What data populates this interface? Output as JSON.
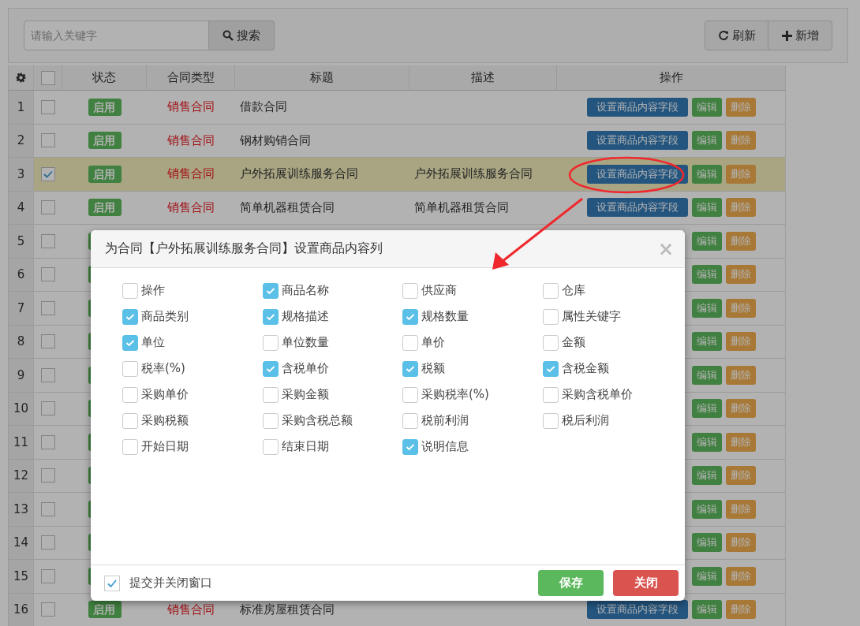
{
  "toolbar": {
    "search": {
      "placeholder": "请输入关键字"
    },
    "search_button": "搜索",
    "refresh_button": "刷新",
    "add_button": "新增"
  },
  "table": {
    "columns": [
      "状态",
      "合同类型",
      "标题",
      "描述",
      "操作"
    ],
    "all_checked": false,
    "rows": [
      {
        "number": "1",
        "checked": false,
        "selected": false,
        "status": "启用",
        "type": "销售合同",
        "title": "借款合同",
        "set_button": "设置商品内容字段",
        "edit_button": "编辑",
        "delete_button": "删除"
      },
      {
        "number": "2",
        "checked": false,
        "selected": false,
        "status": "启用",
        "type": "销售合同",
        "title": "钢材购销合同",
        "set_button": "设置商品内容字段",
        "edit_button": "编辑",
        "delete_button": "删除"
      },
      {
        "number": "3",
        "checked": true,
        "selected": true,
        "status": "启用",
        "type": "销售合同",
        "title": "户外拓展训练服务合同",
        "description": "户外拓展训练服务合同",
        "set_button": "设置商品内容字段",
        "edit_button": "编辑",
        "delete_button": "删除"
      },
      {
        "number": "4",
        "checked": false,
        "selected": false,
        "status": "启用",
        "type": "销售合同",
        "title": "简单机器租赁合同",
        "description": "简单机器租赁合同",
        "set_button": "设置商品内容字段",
        "edit_button": "编辑",
        "delete_button": "删除"
      },
      {
        "number": "5",
        "checked": false,
        "selected": false,
        "edit_button": "编辑",
        "delete_button": "删除"
      },
      {
        "number": "6",
        "checked": false,
        "selected": false,
        "edit_button": "编辑",
        "delete_button": "删除"
      },
      {
        "number": "7",
        "checked": false,
        "selected": false,
        "edit_button": "编辑",
        "delete_button": "删除"
      },
      {
        "number": "8",
        "checked": false,
        "selected": false,
        "edit_button": "编辑",
        "delete_button": "删除"
      },
      {
        "number": "9",
        "checked": false,
        "selected": false,
        "edit_button": "编辑",
        "delete_button": "删除"
      },
      {
        "number": "10",
        "checked": false,
        "selected": false,
        "edit_button": "编辑",
        "delete_button": "删除"
      },
      {
        "number": "11",
        "checked": false,
        "selected": false,
        "edit_button": "编辑",
        "delete_button": "删除"
      },
      {
        "number": "12",
        "checked": false,
        "selected": false,
        "edit_button": "编辑",
        "delete_button": "删除"
      },
      {
        "number": "13",
        "checked": false,
        "selected": false,
        "edit_button": "编辑",
        "delete_button": "删除"
      },
      {
        "number": "14",
        "checked": false,
        "selected": false,
        "edit_button": "编辑",
        "delete_button": "删除"
      },
      {
        "number": "15",
        "checked": false,
        "selected": false,
        "edit_button": "编辑",
        "delete_button": "删除"
      },
      {
        "number": "16",
        "checked": false,
        "selected": false,
        "status": "启用",
        "type": "销售合同",
        "title": "标准房屋租赁合同",
        "set_button": "设置商品内容字段",
        "edit_button": "编辑",
        "delete_button": "删除"
      }
    ]
  },
  "dialog": {
    "title": "为合同【户外拓展训练服务合同】设置商品内容列",
    "close": "×",
    "fields": [
      {
        "label": "操作",
        "checked": false
      },
      {
        "label": "商品名称",
        "checked": true
      },
      {
        "label": "供应商",
        "checked": false
      },
      {
        "label": "仓库",
        "checked": false
      },
      {
        "label": "商品类别",
        "checked": true
      },
      {
        "label": "规格描述",
        "checked": true
      },
      {
        "label": "规格数量",
        "checked": true
      },
      {
        "label": "属性关键字",
        "checked": false
      },
      {
        "label": "单位",
        "checked": true
      },
      {
        "label": "单位数量",
        "checked": false
      },
      {
        "label": "单价",
        "checked": false
      },
      {
        "label": "金额",
        "checked": false
      },
      {
        "label": "税率(%)",
        "checked": false
      },
      {
        "label": "含税单价",
        "checked": true
      },
      {
        "label": "税额",
        "checked": true
      },
      {
        "label": "含税金额",
        "checked": true
      },
      {
        "label": "采购单价",
        "checked": false
      },
      {
        "label": "采购金额",
        "checked": false
      },
      {
        "label": "采购税率(%)",
        "checked": false
      },
      {
        "label": "采购含税单价",
        "checked": false
      },
      {
        "label": "采购税额",
        "checked": false
      },
      {
        "label": "采购含税总额",
        "checked": false
      },
      {
        "label": "税前利润",
        "checked": false
      },
      {
        "label": "税后利润",
        "checked": false
      },
      {
        "label": "开始日期",
        "checked": false
      },
      {
        "label": "结束日期",
        "checked": false
      },
      {
        "label": "说明信息",
        "checked": true
      }
    ],
    "submit_close": {
      "label": "提交并关闭窗口",
      "checked": true
    },
    "save_button": "保存",
    "close_button": "关闭"
  }
}
